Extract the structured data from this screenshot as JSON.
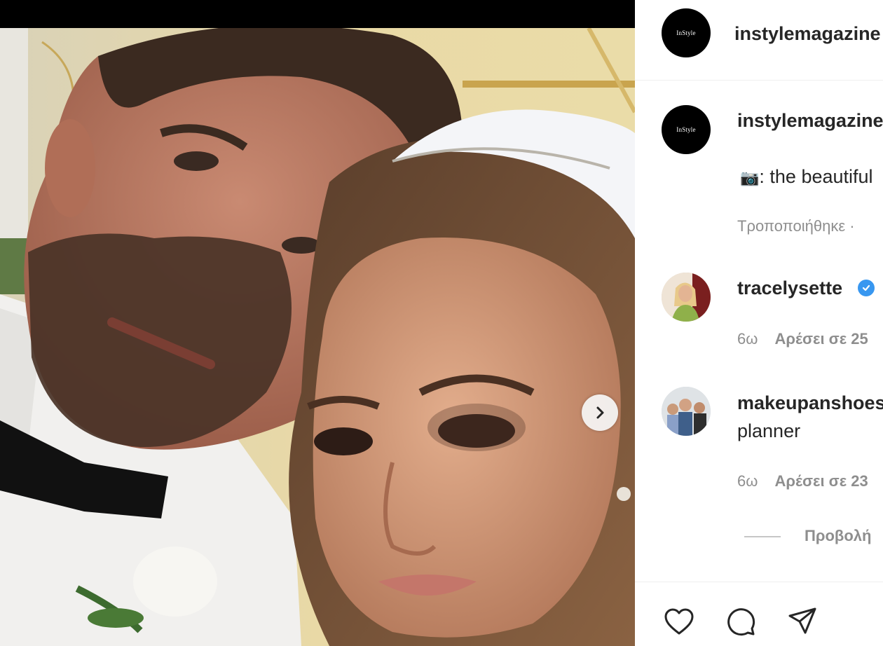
{
  "post": {
    "account": "instylemagazine",
    "avatar_logo_text": "InStyle",
    "caption_emoji": "📷",
    "caption_text": ": the beautiful",
    "edited_label": "Τροποποιήθηκε ·"
  },
  "comments": [
    {
      "username": "tracelysette",
      "verified": true,
      "text": "",
      "age": "6ω",
      "likes": "Αρέσει σε 25"
    },
    {
      "username": "makeupanshoes",
      "verified": false,
      "text": "planner",
      "age": "6ω",
      "likes": "Αρέσει σε 23"
    }
  ],
  "replies": {
    "view_label": "Προβολή"
  },
  "actions": [
    {
      "name": "like",
      "icon": "heart-icon"
    },
    {
      "name": "comment",
      "icon": "speech-bubble-icon"
    },
    {
      "name": "share",
      "icon": "paper-plane-icon"
    }
  ],
  "carousel": {
    "next_icon": "chevron-right-icon"
  },
  "colors": {
    "verified_blue": "#3897f0",
    "meta_gray": "#8e8e8e",
    "text_dark": "#262626"
  }
}
